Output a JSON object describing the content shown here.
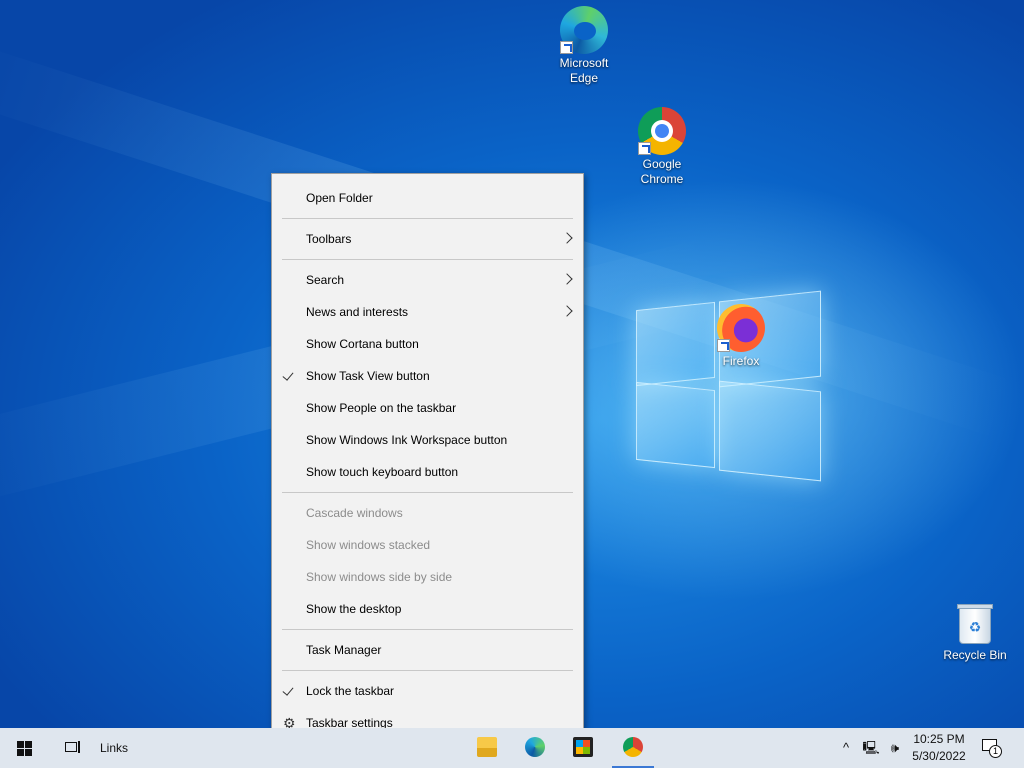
{
  "desktop": {
    "icons": [
      {
        "label": "Microsoft Edge",
        "icon": "edge-icon"
      },
      {
        "label": "Google Chrome",
        "icon": "chrome-icon"
      },
      {
        "label": "Firefox",
        "icon": "firefox-icon"
      },
      {
        "label": "Recycle Bin",
        "icon": "recycle-bin-icon"
      }
    ]
  },
  "context_menu": {
    "items": [
      {
        "label": "Open Folder"
      },
      {
        "label": "Toolbars",
        "submenu": true
      },
      {
        "label": "Search",
        "submenu": true
      },
      {
        "label": "News and interests",
        "submenu": true
      },
      {
        "label": "Show Cortana button"
      },
      {
        "label": "Show Task View button",
        "checked": true
      },
      {
        "label": "Show People on the taskbar"
      },
      {
        "label": "Show Windows Ink Workspace button"
      },
      {
        "label": "Show touch keyboard button"
      },
      {
        "label": "Cascade windows",
        "disabled": true
      },
      {
        "label": "Show windows stacked",
        "disabled": true
      },
      {
        "label": "Show windows side by side",
        "disabled": true
      },
      {
        "label": "Show the desktop"
      },
      {
        "label": "Task Manager"
      },
      {
        "label": "Lock the taskbar",
        "checked": true
      },
      {
        "label": "Taskbar settings",
        "icon": "gear-icon"
      }
    ]
  },
  "taskbar": {
    "links_label": "Links",
    "pinned_apps": [
      "file-explorer-icon",
      "edge-icon",
      "store-icon",
      "chrome-icon"
    ],
    "active_app": "chrome-icon",
    "tray": {
      "overflow_icon": "chevron-up-icon",
      "network_icon": "network-icon",
      "volume_icon": "volume-icon"
    },
    "clock": {
      "time": "10:25 PM",
      "date": "5/30/2022"
    },
    "notifications": {
      "count": "1",
      "icon": "notification-icon"
    }
  },
  "colors": {
    "accent": "#3b78d4",
    "menu_bg": "#f2f2f2",
    "taskbar_bg": "#dfe6ee",
    "disabled_text": "#8c8c8c"
  }
}
